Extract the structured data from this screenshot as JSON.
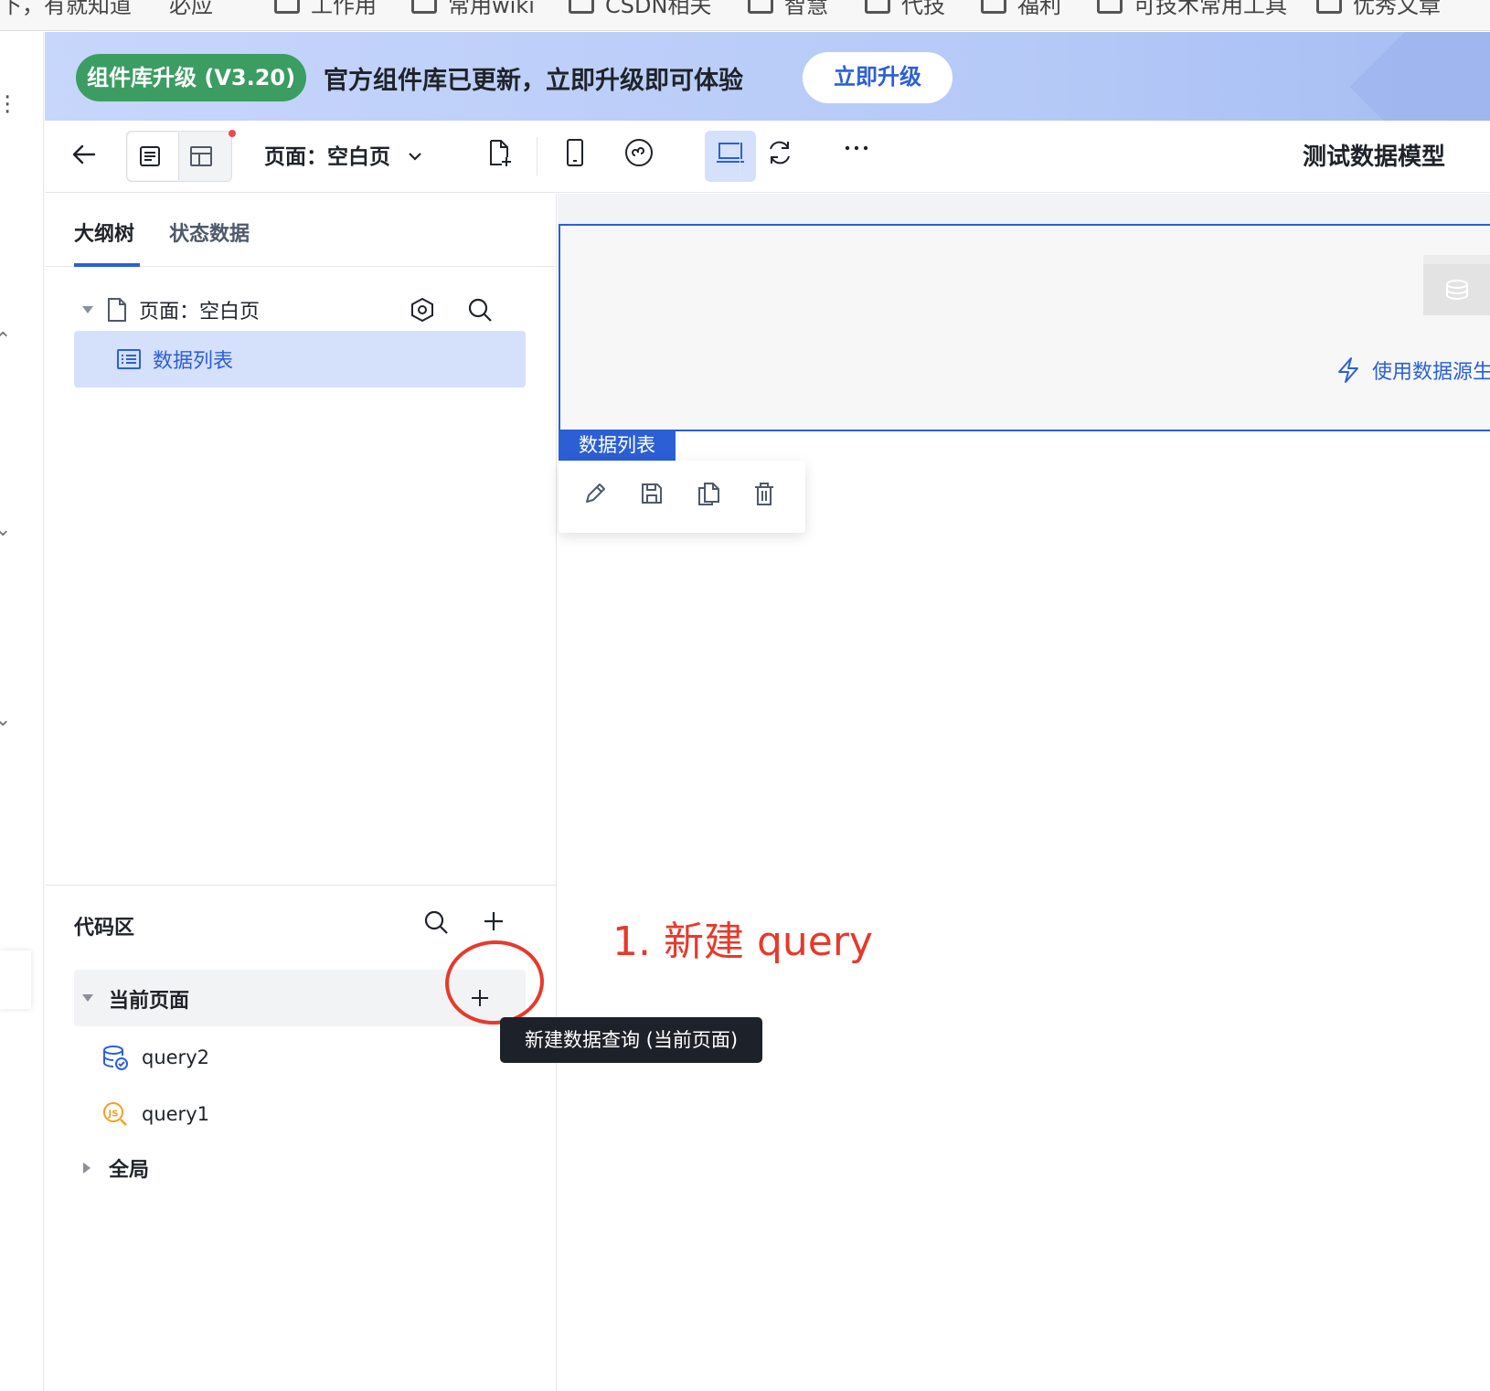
{
  "browser": {
    "bookmarks": [
      "下，有就知道",
      "必应",
      "工作用",
      "常用wiki",
      "CSDN相关",
      "智慧",
      "代技",
      "福利",
      "可技术常用工具",
      "优秀文章"
    ]
  },
  "banner": {
    "badge": "组件库升级 (V3.20)",
    "message": "官方组件库已更新，立即升级即可体验",
    "upgrade_button": "立即升级"
  },
  "toolbar": {
    "page_select_label": "页面：空白页",
    "app_title": "测试数据模型"
  },
  "left_panel": {
    "tabs": [
      {
        "label": "大纲树",
        "active": true
      },
      {
        "label": "状态数据",
        "active": false
      }
    ],
    "tree": {
      "page_label": "页面：空白页",
      "component_label": "数据列表"
    },
    "code_area": {
      "title": "代码区",
      "current_page_group": "当前页面",
      "queries": [
        {
          "name": "query2",
          "icon": "database-query-icon"
        },
        {
          "name": "query1",
          "icon": "js-query-icon"
        }
      ],
      "global_group": "全局"
    }
  },
  "tooltip": {
    "text": "新建数据查询 (当前页面)"
  },
  "canvas": {
    "use_datasource_text": "使用数据源生",
    "component_tag": "数据列表"
  },
  "annotation": {
    "text": "1. 新建 query",
    "color": "#e53a2c"
  },
  "colors": {
    "accent": "#2c5fd6",
    "badge_green": "#3b9d62",
    "selected_bg": "#d5e0fb",
    "tooltip_bg": "#1d2129"
  }
}
